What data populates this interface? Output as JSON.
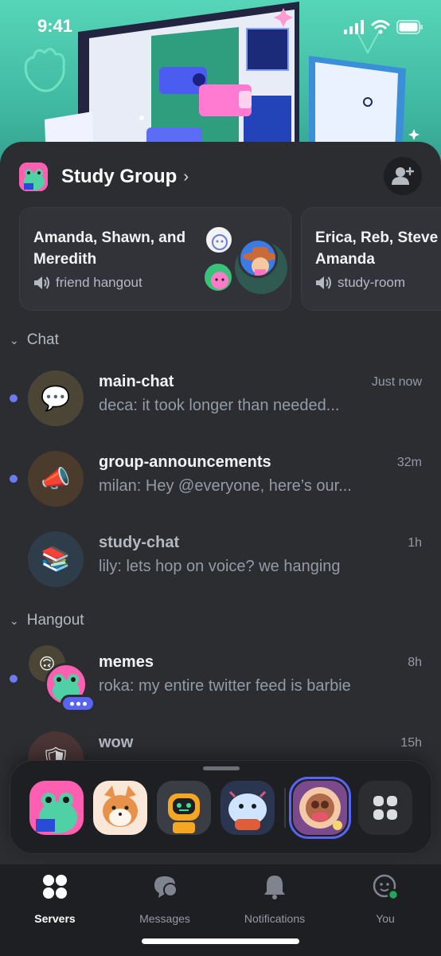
{
  "status_bar": {
    "time": "9:41"
  },
  "server": {
    "name": "Study Group"
  },
  "voice_rooms": [
    {
      "members": "Amanda, Shawn, and Meredith",
      "room": "friend hangout"
    },
    {
      "members": "Erica, Reb, Steve Amanda",
      "room": "study-room"
    }
  ],
  "categories": [
    {
      "name": "Chat",
      "channels": [
        {
          "name": "main-chat",
          "time": "Just now",
          "preview": "deca: it took longer than needed...",
          "emoji": "💬",
          "unread": true
        },
        {
          "name": "group-announcements",
          "time": "32m",
          "preview": "milan: Hey @everyone, here’s our...",
          "emoji": "📣",
          "unread": true
        },
        {
          "name": "study-chat",
          "time": "1h",
          "preview": "lily: lets hop on voice? we hanging",
          "emoji": "📚",
          "unread": false
        }
      ]
    },
    {
      "name": "Hangout",
      "channels": [
        {
          "name": "memes",
          "time": "8h",
          "preview": "roka: my entire twitter feed is barbie",
          "unread": true
        },
        {
          "name": "wow",
          "time": "15h",
          "preview": "",
          "emoji": "🛡",
          "unread": false
        }
      ]
    }
  ],
  "tabs": [
    {
      "label": "Servers",
      "icon": "servers-icon",
      "active": true
    },
    {
      "label": "Messages",
      "icon": "messages-icon",
      "active": false
    },
    {
      "label": "Notifications",
      "icon": "bell-icon",
      "active": false
    },
    {
      "label": "You",
      "icon": "you-icon",
      "active": false
    }
  ],
  "colors": {
    "accent": "#5865f2",
    "unread_dot": "#6d7bf3",
    "sheet_bg": "#2b2d31",
    "online": "#23a55a"
  }
}
